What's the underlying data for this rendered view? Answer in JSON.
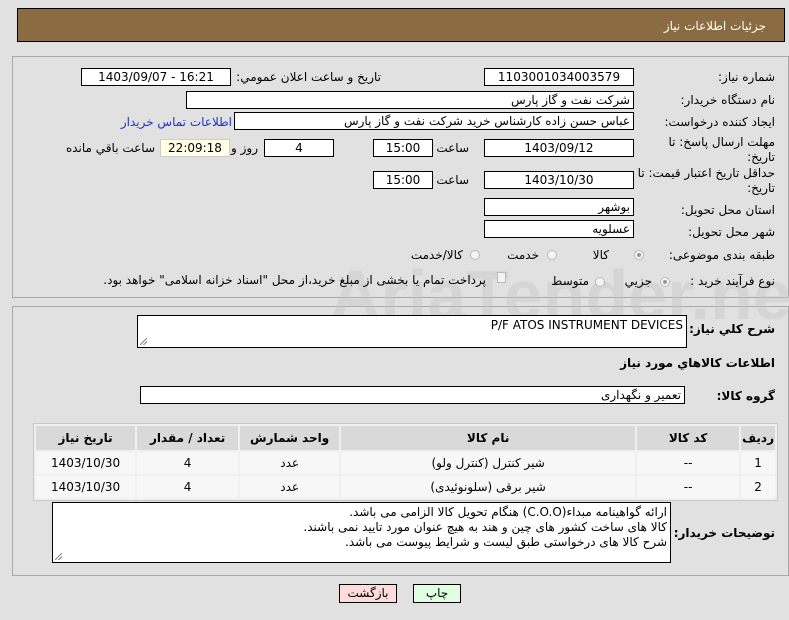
{
  "header": {
    "title": "جزئیات اطلاعات نیاز"
  },
  "form": {
    "need_number_label": "شماره نیاز:",
    "need_number": "1103001034003579",
    "announce_label": "تاریخ و ساعت اعلان عمومي:",
    "announce_value": "1403/09/07 - 16:21",
    "buyer_label": "نام دستگاه خريدار:",
    "buyer_value": "شرکت نفت و گاز پارس",
    "creator_label": "ايجاد کننده درخواست:",
    "creator_value": "عباس حسن زاده کارشناس خرید شرکت نفت و گاز پارس",
    "contact_link": "اطلاعات تماس خريدار",
    "deadline_label": "مهلت ارسال پاسخ: تا تاريخ:",
    "deadline_date": "1403/09/12",
    "time_label": "ساعت",
    "deadline_time": "15:00",
    "days": "4",
    "days_label": "روز و",
    "remaining": "22:09:18",
    "remaining_label": "ساعت باقي مانده",
    "validity_label": "حداقل تاريخ اعتبار قيمت: تا تاريخ:",
    "validity_date": "1403/10/30",
    "validity_time": "15:00",
    "province_label": "استان محل تحويل:",
    "province": "بوشهر",
    "city_label": "شهر محل تحويل:",
    "city": "عسلویه",
    "category_label": "طبقه بندی موضوعی:",
    "category_options": [
      "کالا",
      "خدمت",
      "کالا/خدمت"
    ],
    "process_label": "نوع فرآيند خريد :",
    "process_options": [
      "جزيي",
      "متوسط"
    ],
    "payment_note": "پرداخت تمام يا بخشی از مبلغ خريد،از محل \"اسناد خزانه اسلامی\" خواهد بود."
  },
  "details": {
    "summary_label": "شرح کلي نياز:",
    "summary": "P/F ATOS INSTRUMENT DEVICES",
    "goods_title": "اطلاعات کالاهاي مورد نياز",
    "group_label": "گروه کالا:",
    "group": "تعمیر و نگهداری",
    "table": {
      "headers": [
        "رديف",
        "کد کالا",
        "نام کالا",
        "واحد شمارش",
        "تعداد / مقدار",
        "تاريخ نياز"
      ],
      "rows": [
        [
          "1",
          "--",
          "شیر کنترل (کنترل ولو)",
          "عدد",
          "4",
          "1403/10/30"
        ],
        [
          "2",
          "--",
          "شیر برقی (سلونوئیدی)",
          "عدد",
          "4",
          "1403/10/30"
        ]
      ]
    },
    "notes_label": "توضيحات خريدار:",
    "notes": [
      "ارائه گواهینامه مبداء(C.O.O) هنگام تحویل کالا الزامی می باشد.",
      "کالا های ساخت کشور های چین و هند به هیچ عنوان مورد تایید نمی باشند.",
      "شرح کالا های درخواستی طبق لیست و شرایط پیوست می باشد."
    ]
  },
  "buttons": {
    "print": "چاپ",
    "back": "بازگشت"
  },
  "watermark": "AriaTender.net"
}
